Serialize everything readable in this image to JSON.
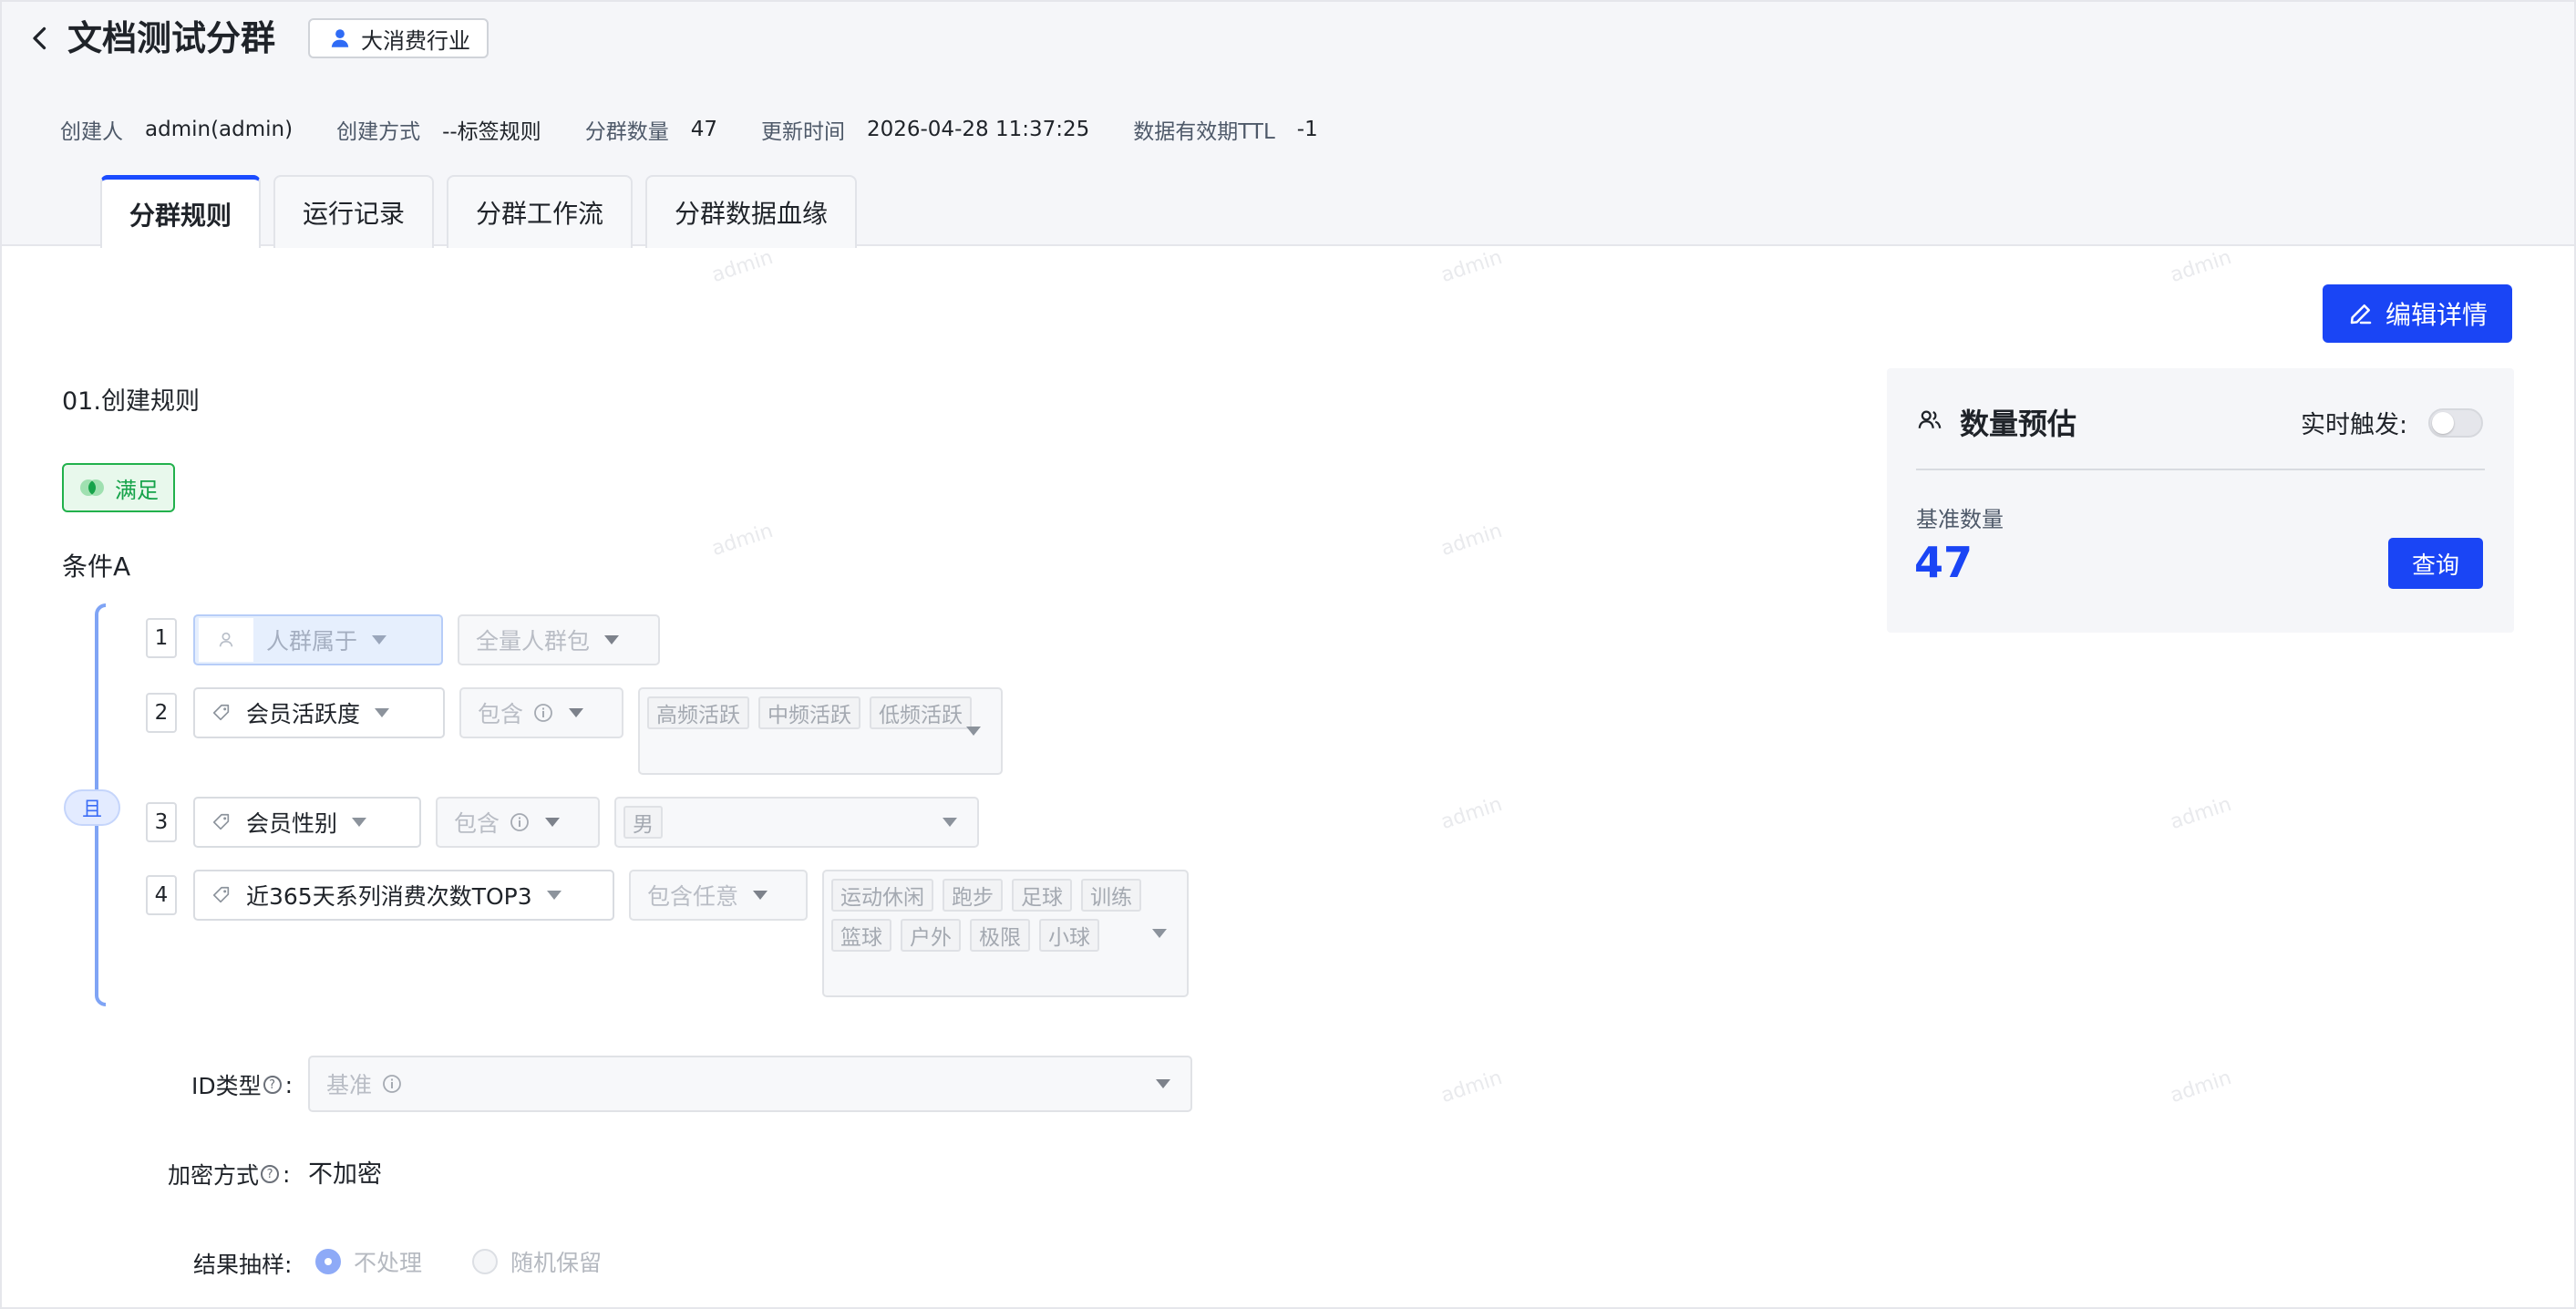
{
  "header": {
    "title": "文档测试分群",
    "industry_tag": "大消费行业",
    "meta": [
      {
        "label": "创建人",
        "value": "admin(admin)"
      },
      {
        "label": "创建方式",
        "value": "--标签规则"
      },
      {
        "label": "分群数量",
        "value": "47"
      },
      {
        "label": "更新时间",
        "value": "2026-04-28 11:37:25"
      },
      {
        "label": "数据有效期TTL",
        "value": "-1"
      }
    ],
    "tabs": [
      {
        "label": "分群规则",
        "active": true
      },
      {
        "label": "运行记录",
        "active": false
      },
      {
        "label": "分群工作流",
        "active": false
      },
      {
        "label": "分群数据血缘",
        "active": false
      }
    ]
  },
  "toolbar": {
    "edit_label": "编辑详情"
  },
  "rules": {
    "section_title": "01.创建规则",
    "satisfy_label": "满足",
    "condition_label": "条件A",
    "and_label": "且",
    "items": [
      {
        "index": "1",
        "field": "人群属于",
        "operator": "全量人群包",
        "values": []
      },
      {
        "index": "2",
        "field": "会员活跃度",
        "operator": "包含",
        "values": [
          "高频活跃",
          "中频活跃",
          "低频活跃"
        ]
      },
      {
        "index": "3",
        "field": "会员性别",
        "operator": "包含",
        "values": [
          "男"
        ]
      },
      {
        "index": "4",
        "field": "近365天系列消费次数TOP3",
        "operator": "包含任意",
        "values": [
          "运动休闲",
          "跑步",
          "足球",
          "训练",
          "篮球",
          "户外",
          "极限",
          "小球"
        ]
      }
    ]
  },
  "form": {
    "id_type_label": "ID类型",
    "id_type_value": "基准",
    "encrypt_label": "加密方式",
    "encrypt_value": "不加密",
    "sampling_label": "结果抽样:",
    "colon": ":",
    "help_mark": "?",
    "sampling_options": [
      {
        "label": "不处理",
        "checked": true
      },
      {
        "label": "随机保留",
        "checked": false
      }
    ]
  },
  "estimate": {
    "title": "数量预估",
    "realtime_label": "实时触发:",
    "realtime_on": false,
    "base_label": "基准数量",
    "base_value": "47",
    "query_label": "查询"
  },
  "watermark_text": "admin",
  "colors": {
    "primary": "#1a45f5",
    "success": "#16a34a",
    "bracket": "#7fa4f5"
  }
}
